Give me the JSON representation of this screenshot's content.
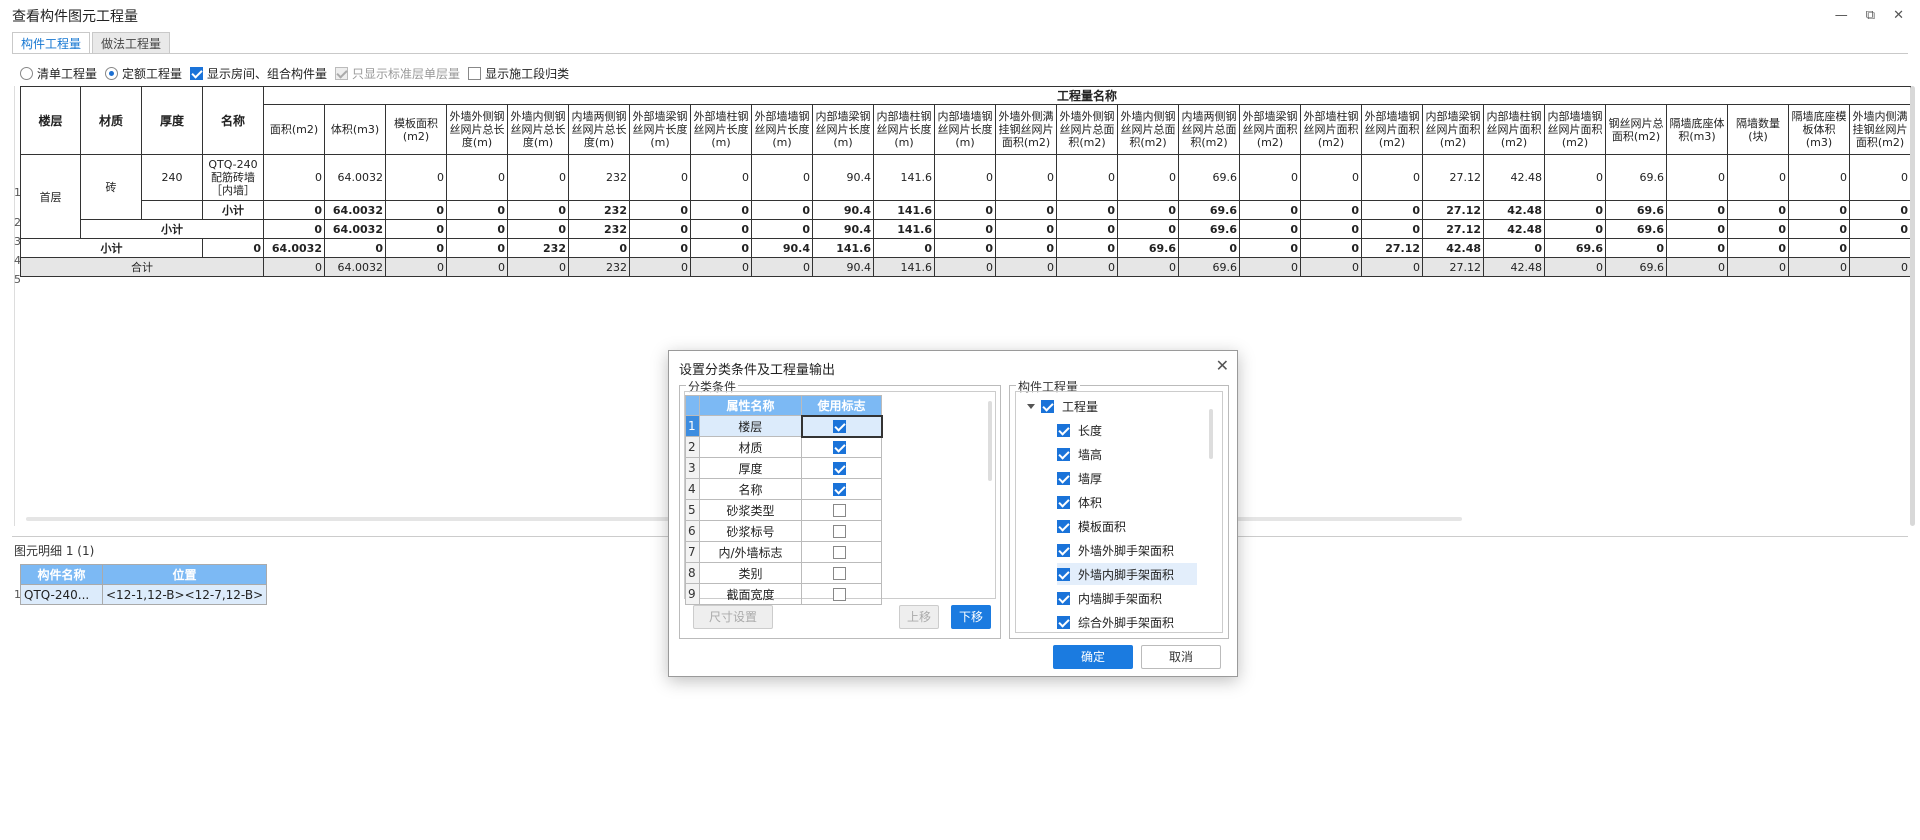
{
  "window": {
    "title": "查看构件图元工程量",
    "controls": [
      "—",
      "⧉",
      "✕"
    ]
  },
  "tabs": [
    {
      "label": "构件工程量"
    },
    {
      "label": "做法工程量"
    }
  ],
  "options": {
    "radio_list": "清单工程量",
    "radio_quota": "定额工程量",
    "cb_rooms": "显示房间、组合构件量",
    "cb_std": "只显示标准层单层量",
    "cb_stage": "显示施工段归类"
  },
  "table": {
    "group_header": "工程量名称",
    "fixed_headers": [
      "楼层",
      "材质",
      "厚度",
      "名称"
    ],
    "columns": [
      "面积(m2)",
      "体积(m3)",
      "模板面积(m2)",
      "外墙外侧钢丝网片总长度(m)",
      "外墙内侧钢丝网片总长度(m)",
      "内墙两侧钢丝网片总长度(m)",
      "外部墙梁钢丝网片长度(m)",
      "外部墙柱钢丝网片长度(m)",
      "外部墙墙钢丝网片长度(m)",
      "内部墙梁钢丝网片长度(m)",
      "内部墙柱钢丝网片长度(m)",
      "内部墙墙钢丝网片长度(m)",
      "外墙外侧满挂钢丝网片面积(m2)",
      "外墙外侧钢丝网片总面积(m2)",
      "外墙内侧钢丝网片总面积(m2)",
      "内墙两侧钢丝网片总面积(m2)",
      "外部墙梁钢丝网片面积(m2)",
      "外部墙柱钢丝网片面积(m2)",
      "外部墙墙钢丝网片面积(m2)",
      "内部墙梁钢丝网片面积(m2)",
      "内部墙柱钢丝网片面积(m2)",
      "内部墙墙钢丝网片面积(m2)",
      "钢丝网片总面积(m2)",
      "隔墙底座体积(m3)",
      "隔墙数量(块)",
      "隔墙底座模板体积(m3)",
      "外墙内侧满挂钢丝网片面积(m2)"
    ],
    "row_numbers": [
      "1",
      "2",
      "3",
      "4",
      "5"
    ],
    "floor": "首层",
    "material": "砖",
    "thickness": "240",
    "name": "QTQ-240配筋砖墙［内墙］",
    "label_subtotal": "小计",
    "label_total": "合计",
    "values": [
      "0",
      "64.0032",
      "0",
      "0",
      "0",
      "232",
      "0",
      "0",
      "0",
      "90.4",
      "141.6",
      "0",
      "0",
      "0",
      "0",
      "69.6",
      "0",
      "0",
      "0",
      "27.12",
      "42.48",
      "0",
      "69.6",
      "0",
      "0",
      "0",
      "0"
    ]
  },
  "detail": {
    "title": "图元明细   1 (1)",
    "headers": [
      "构件名称",
      "位置"
    ],
    "row_number": "1",
    "row": [
      "QTQ-240...",
      "<12-1,12-B><12-7,12-B>"
    ]
  },
  "dialog": {
    "title": "设置分类条件及工程量输出",
    "close": "✕",
    "left_group": "分类条件",
    "grid_headers": [
      "属性名称",
      "使用标志"
    ],
    "rows": [
      {
        "num": "1",
        "name": "楼层",
        "checked": true
      },
      {
        "num": "2",
        "name": "材质",
        "checked": true
      },
      {
        "num": "3",
        "name": "厚度",
        "checked": true
      },
      {
        "num": "4",
        "name": "名称",
        "checked": true
      },
      {
        "num": "5",
        "name": "砂浆类型",
        "checked": false
      },
      {
        "num": "6",
        "name": "砂浆标号",
        "checked": false
      },
      {
        "num": "7",
        "name": "内/外墙标志",
        "checked": false
      },
      {
        "num": "8",
        "name": "类别",
        "checked": false
      },
      {
        "num": "9",
        "name": "截面宽度",
        "checked": false
      }
    ],
    "btn_size": "尺寸设置",
    "btn_up": "上移",
    "btn_down": "下移",
    "right_group": "构件工程量",
    "tree_root": "工程量",
    "tree_items": [
      "长度",
      "墙高",
      "墙厚",
      "体积",
      "模板面积",
      "外墙外脚手架面积",
      "外墙内脚手架面积",
      "内墙脚手架面积",
      "综合外脚手架面积"
    ],
    "ok": "确定",
    "cancel": "取消"
  }
}
